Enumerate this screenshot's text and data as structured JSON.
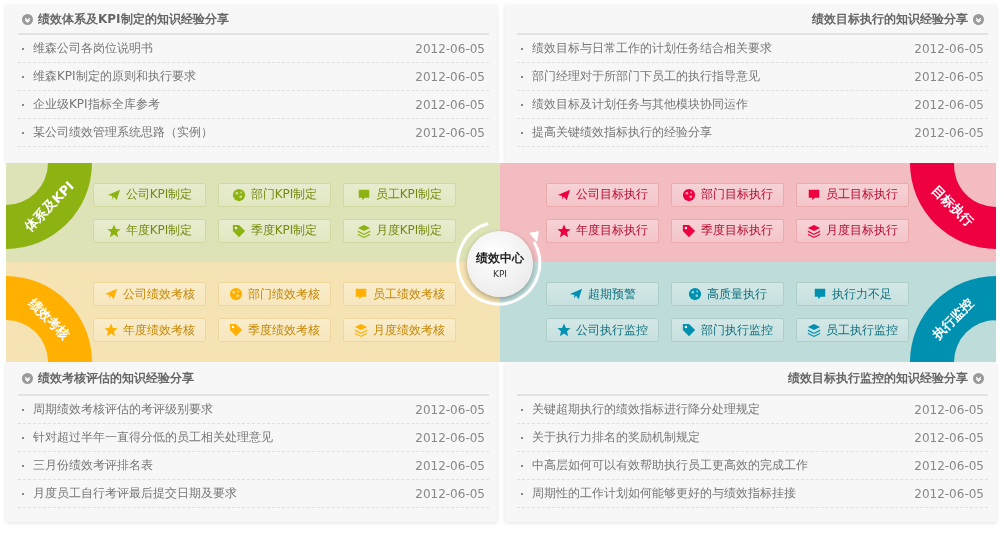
{
  "panels_top": [
    {
      "title": "绩效体系及KPI制定的知识经验分享",
      "items": [
        {
          "title": "维森公司各岗位说明书",
          "date": "2012-06-05"
        },
        {
          "title": "维森KPI制定的原则和执行要求",
          "date": "2012-06-05"
        },
        {
          "title": "企业级KPI指标全库参考",
          "date": "2012-06-05"
        },
        {
          "title": "某公司绩效管理系统思路（实例）",
          "date": "2012-06-05"
        }
      ]
    },
    {
      "title": "绩效目标执行的知识经验分享",
      "items": [
        {
          "title": "绩效目标与日常工作的计划任务结合相关要求",
          "date": "2012-06-05"
        },
        {
          "title": "部门经理对于所部门下员工的执行指导意见",
          "date": "2012-06-05"
        },
        {
          "title": "绩效目标及计划任务与其他模块协同运作",
          "date": "2012-06-05"
        },
        {
          "title": "提高关键绩效指标执行的经验分享",
          "date": "2012-06-05"
        }
      ]
    }
  ],
  "quadrants": [
    {
      "label": "体系及KPI",
      "color": "#8db312",
      "buttons": [
        {
          "label": "公司KPI制定"
        },
        {
          "label": "部门KPI制定"
        },
        {
          "label": "员工KPI制定"
        },
        {
          "label": "年度KPI制定"
        },
        {
          "label": "季度KPI制定"
        },
        {
          "label": "月度KPI制定"
        }
      ]
    },
    {
      "label": "目标执行",
      "color": "#ee0040",
      "buttons": [
        {
          "label": "公司目标执行"
        },
        {
          "label": "部门目标执行"
        },
        {
          "label": "员工目标执行"
        },
        {
          "label": "年度目标执行"
        },
        {
          "label": "季度目标执行"
        },
        {
          "label": "月度目标执行"
        }
      ]
    },
    {
      "label": "绩效考核",
      "color": "#ffb000",
      "buttons": [
        {
          "label": "公司绩效考核"
        },
        {
          "label": "部门绩效考核"
        },
        {
          "label": "员工绩效考核"
        },
        {
          "label": "年度绩效考核"
        },
        {
          "label": "季度绩效考核"
        },
        {
          "label": "月度绩效考核"
        }
      ]
    },
    {
      "label": "执行监控",
      "color": "#0090b0",
      "buttons": [
        {
          "label": "超期预警"
        },
        {
          "label": "高质量执行"
        },
        {
          "label": "执行力不足"
        },
        {
          "label": "公司执行监控"
        },
        {
          "label": "部门执行监控"
        },
        {
          "label": "员工执行监控"
        }
      ]
    }
  ],
  "center": {
    "title": "绩效中心",
    "subtitle": "KPI"
  },
  "panels_bottom": [
    {
      "title": "绩效考核评估的知识经验分享",
      "items": [
        {
          "title": "周期绩效考核评估的考评级别要求",
          "date": "2012-06-05"
        },
        {
          "title": "针对超过半年一直得分低的员工相关处理意见",
          "date": "2012-06-05"
        },
        {
          "title": "三月份绩效考评排名表",
          "date": "2012-06-05"
        },
        {
          "title": "月度员工自行考评最后提交日期及要求",
          "date": "2012-06-05"
        }
      ]
    },
    {
      "title": "绩效目标执行监控的知识经验分享",
      "items": [
        {
          "title": "关键超期执行的绩效指标进行降分处理规定",
          "date": "2012-06-05"
        },
        {
          "title": "关于执行力排名的奖励机制规定",
          "date": "2012-06-05"
        },
        {
          "title": "中高层如何可以有效帮助执行员工更高效的完成工作",
          "date": "2012-06-05"
        },
        {
          "title": "周期性的工作计划如何能够更好的与绩效指标挂接",
          "date": "2012-06-05"
        }
      ]
    }
  ]
}
